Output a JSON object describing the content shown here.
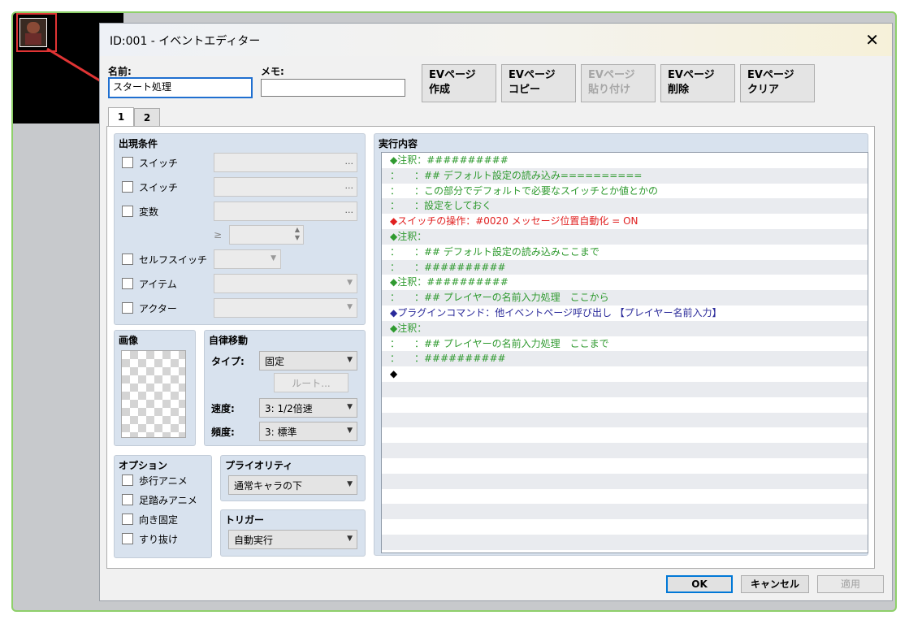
{
  "window": {
    "title": "ID:001 - イベントエディター",
    "close_icon": "close-icon"
  },
  "fields": {
    "name_label": "名前:",
    "name_value": "スタート処理",
    "memo_label": "メモ:",
    "memo_value": ""
  },
  "ev_buttons": [
    {
      "line1": "EVページ",
      "line2": "作成",
      "enabled": true
    },
    {
      "line1": "EVページ",
      "line2": "コピー",
      "enabled": true
    },
    {
      "line1": "EVページ",
      "line2": "貼り付け",
      "enabled": false
    },
    {
      "line1": "EVページ",
      "line2": "削除",
      "enabled": true
    },
    {
      "line1": "EVページ",
      "line2": "クリア",
      "enabled": true
    }
  ],
  "tabs": [
    "1",
    "2"
  ],
  "conditions": {
    "title": "出現条件",
    "rows": [
      {
        "label": "スイッチ",
        "dots": "..."
      },
      {
        "label": "スイッチ",
        "dots": "..."
      },
      {
        "label": "変数",
        "dots": "..."
      }
    ],
    "ge_symbol": "≥",
    "self_switch_label": "セルフスイッチ",
    "item_label": "アイテム",
    "actor_label": "アクター"
  },
  "image": {
    "title": "画像"
  },
  "autonomous": {
    "title": "自律移動",
    "type_label": "タイプ:",
    "type_value": "固定",
    "route_button": "ルート...",
    "speed_label": "速度:",
    "speed_value": "3: 1/2倍速",
    "freq_label": "頻度:",
    "freq_value": "3: 標準"
  },
  "options": {
    "title": "オプション",
    "items": [
      "歩行アニメ",
      "足踏みアニメ",
      "向き固定",
      "すり抜け"
    ]
  },
  "priority": {
    "title": "プライオリティ",
    "value": "通常キャラの下"
  },
  "trigger": {
    "title": "トリガー",
    "value": "自動実行"
  },
  "contents": {
    "title": "実行内容",
    "lines": [
      {
        "text": "◆注釈：##########",
        "color": "#2f9a2f"
      },
      {
        "text": "：　　：## デフォルト設定の読み込み==========",
        "color": "#2f9a2f"
      },
      {
        "text": "：　　：この部分でデフォルトで必要なスイッチとか値とかの",
        "color": "#2f9a2f"
      },
      {
        "text": "：　　：設定をしておく",
        "color": "#2f9a2f"
      },
      {
        "text": "◆スイッチの操作：#0020 メッセージ位置自動化 = ON",
        "color": "#e02020"
      },
      {
        "text": "◆注釈：",
        "color": "#2f9a2f"
      },
      {
        "text": "：　　：## デフォルト設定の読み込みここまで",
        "color": "#2f9a2f"
      },
      {
        "text": "：　　：##########",
        "color": "#2f9a2f"
      },
      {
        "text": "◆注釈：##########",
        "color": "#2f9a2f"
      },
      {
        "text": "：　　：## プレイヤーの名前入力処理　ここから",
        "color": "#2f9a2f"
      },
      {
        "text": "◆プラグインコマンド：他イベントページ呼び出し 【プレイヤー名前入力】",
        "color": "#2a2a9a"
      },
      {
        "text": "◆注釈：",
        "color": "#2f9a2f"
      },
      {
        "text": "：　　：## プレイヤーの名前入力処理　ここまで",
        "color": "#2f9a2f"
      },
      {
        "text": "：　　：##########",
        "color": "#2f9a2f"
      },
      {
        "text": "◆",
        "color": "#000000"
      }
    ]
  },
  "footer": {
    "ok": "OK",
    "cancel": "キャンセル",
    "apply": "適用"
  },
  "colors": {
    "accent": "#0078d7",
    "highlight_box": "#e03434",
    "panel_bg": "#d8e2ee"
  }
}
